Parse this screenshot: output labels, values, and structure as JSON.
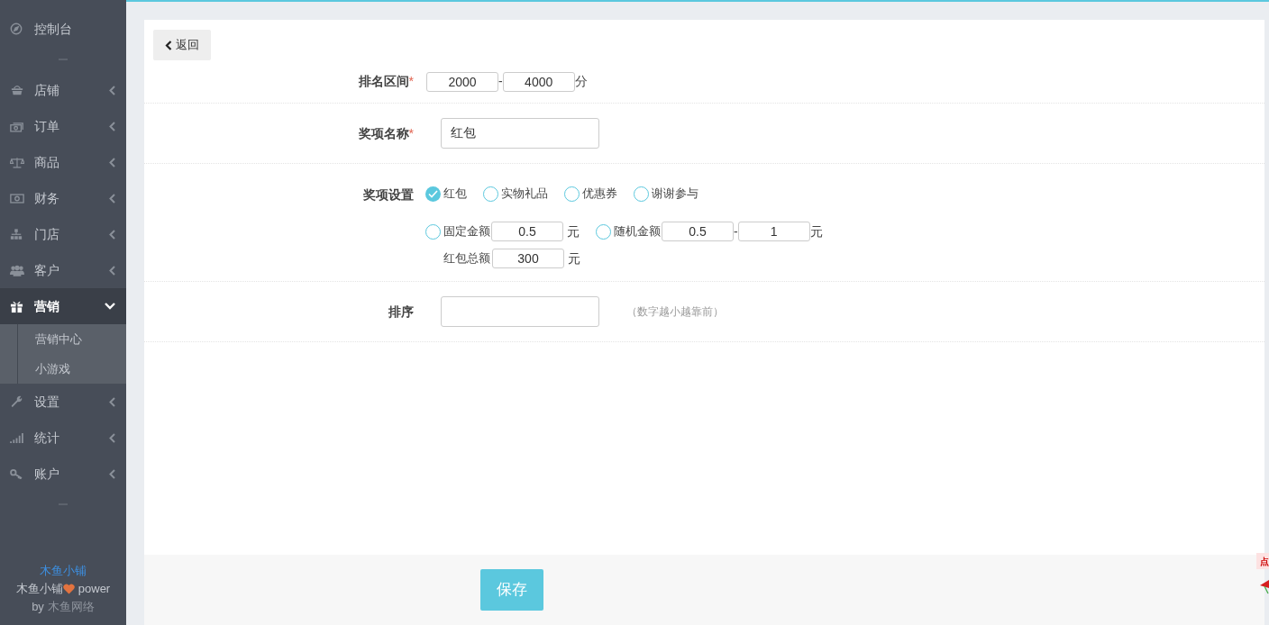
{
  "sidebar": {
    "items": [
      {
        "label": "控制台"
      },
      {
        "label": "店铺",
        "expanded": false
      },
      {
        "label": "订单",
        "expanded": false
      },
      {
        "label": "商品",
        "expanded": false
      },
      {
        "label": "财务",
        "expanded": false
      },
      {
        "label": "门店",
        "expanded": false
      },
      {
        "label": "客户",
        "expanded": false
      },
      {
        "label": "营销",
        "expanded": true,
        "children": [
          {
            "label": "营销中心"
          },
          {
            "label": "小游戏"
          }
        ]
      },
      {
        "label": "设置",
        "expanded": false
      },
      {
        "label": "统计",
        "expanded": false
      },
      {
        "label": "账户",
        "expanded": false
      }
    ],
    "footer": {
      "brand": "木鱼小铺",
      "power_name": "木鱼小铺",
      "power_word": "power",
      "credit_by": "by",
      "credit_company": "木鱼网络"
    }
  },
  "back_button": "返回",
  "form": {
    "rows": [
      {
        "kind": "range",
        "label": "排名区间",
        "mark": "*",
        "from": "2000",
        "separator": "-",
        "to": "4000",
        "unit": "分"
      },
      {
        "kind": "text",
        "label": "奖项名称",
        "mark": "*",
        "value": "红包"
      },
      {
        "kind": "prize",
        "label": "奖项设置",
        "options": [
          {
            "label": "红包",
            "selected": true
          },
          {
            "label": "实物礼品",
            "selected": false
          },
          {
            "label": "优惠券",
            "selected": false
          },
          {
            "label": "谢谢参与",
            "selected": false
          }
        ],
        "amounts": [
          {
            "kind": "fixed",
            "label": "固定金额",
            "selected": false,
            "value": "0.5",
            "unit": "元"
          },
          {
            "kind": "random",
            "label": "随机金额",
            "selected": false,
            "min": "0.5",
            "separator": "-",
            "max": "1",
            "unit": "元"
          }
        ],
        "total": {
          "label": "红包总额",
          "value": "300",
          "unit": "元"
        }
      },
      {
        "kind": "text",
        "label": "排序",
        "hint": "（数字越小越靠前）"
      }
    ]
  },
  "save_button": "保存",
  "float_badge": "点"
}
